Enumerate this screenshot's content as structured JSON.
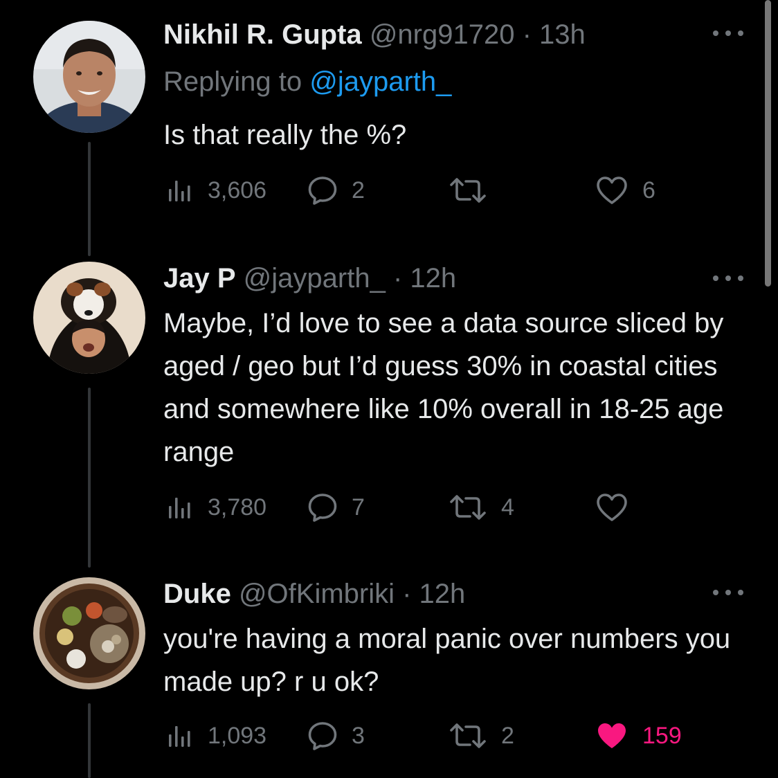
{
  "tweets": [
    {
      "name": "Nikhil R. Gupta",
      "handle": "@nrg91720",
      "time": "· 13h",
      "replying_prefix": "Replying to ",
      "replying_handle": "@jayparth_",
      "text": "Is that really the %?",
      "views": "3,606",
      "replies": "2",
      "retweets": "",
      "likes": "6",
      "liked": false
    },
    {
      "name": "Jay P",
      "handle": "@jayparth_",
      "time": "· 12h",
      "text": "Maybe, I’d love to see a data source sliced by aged / geo but I’d guess 30% in coastal cities and somewhere like 10% overall in 18-25 age range",
      "views": "3,780",
      "replies": "7",
      "retweets": "4",
      "likes": "",
      "liked": false
    },
    {
      "name": "Duke",
      "handle": "@OfKimbriki",
      "time": "· 12h",
      "text": "you're having a moral panic over numbers you made up? r u ok?",
      "views": "1,093",
      "replies": "3",
      "retweets": "2",
      "likes": "159",
      "liked": true
    }
  ],
  "icons": {
    "views": "analytics-icon",
    "reply": "reply-icon",
    "retweet": "retweet-icon",
    "like": "heart-icon",
    "more": "more-options-icon"
  },
  "colors": {
    "background": "#000000",
    "primary_text": "#e7e9ea",
    "secondary_text": "#71767b",
    "link": "#1d9bf0",
    "like_active": "#f91880"
  }
}
